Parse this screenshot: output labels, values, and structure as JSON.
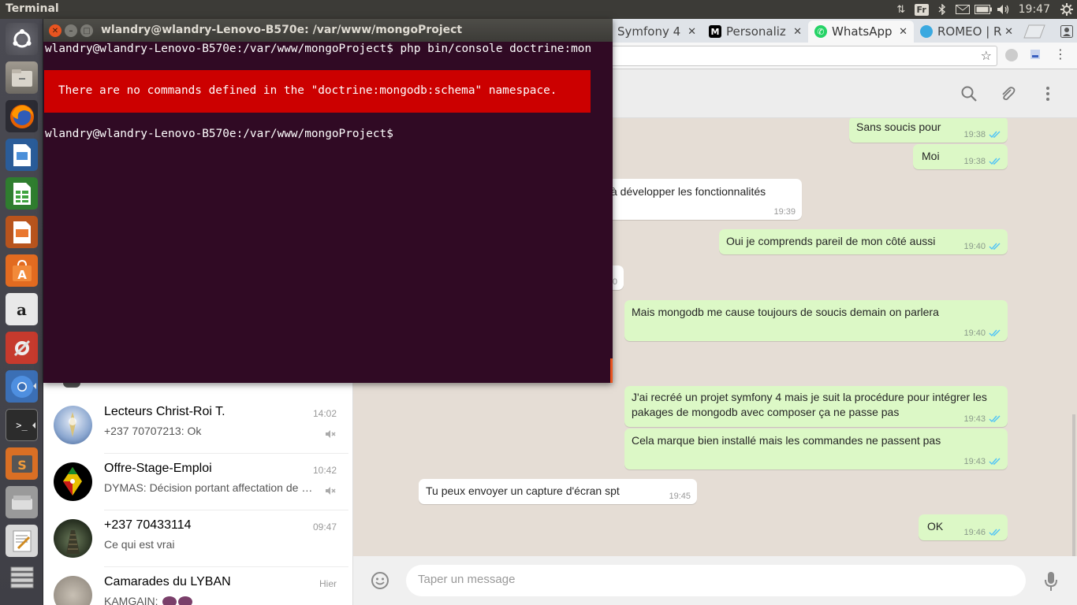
{
  "topbar": {
    "app_title": "Terminal",
    "lang": "Fr",
    "clock": "19:47"
  },
  "terminal": {
    "title": "wlandry@wlandry-Lenovo-B570e: /var/www/mongoProject",
    "line1": "wlandry@wlandry-Lenovo-B570e:/var/www/mongoProject$ php bin/console doctrine:mon",
    "error": "There are no commands defined in the \"doctrine:mongodb:schema\" namespace.",
    "line2": "wlandry@wlandry-Lenovo-B570e:/var/www/mongoProject$"
  },
  "browser": {
    "tabs": [
      {
        "label": "Symfony 4"
      },
      {
        "label": "Personaliz"
      },
      {
        "label": "WhatsApp"
      },
      {
        "label": "ROMEO | R"
      }
    ]
  },
  "chats": [
    {
      "name": "Lecteurs Christ-Roi T.",
      "time": "14:02",
      "preview": "+237 70707213: Ok"
    },
    {
      "name": "Offre-Stage-Emploi",
      "time": "10:42",
      "preview": "DYMAS: Décision portant affectation de c..."
    },
    {
      "name": "+237 70433114",
      "time": "09:47",
      "preview": "Ce qui est vrai"
    },
    {
      "name": "Camarades du LYBAN",
      "time": "Hier",
      "preview": "KAMGAIN: "
    }
  ],
  "messages": [
    {
      "text": "Sans soucis pour",
      "time": "19:38"
    },
    {
      "text": "Moi",
      "time": "19:38"
    },
    {
      "text": "à  développer  les fonctionnalités",
      "time": "19:39"
    },
    {
      "text": "Oui je comprends pareil de mon côté aussi",
      "time": "19:40"
    },
    {
      "text": "0",
      "time": ""
    },
    {
      "text": "Mais mongodb me cause toujours de soucis demain on parlera",
      "time": "19:40"
    },
    {
      "text": "J'ai recréé un projet symfony 4 mais je suit la procédure pour intégrer les",
      "text2": "pakages de mongodb avec composer ça ne passe pas",
      "time": "19:43"
    },
    {
      "text": "Cela marque bien installé mais les commandes ne passent pas",
      "time": "19:43"
    },
    {
      "text": "Tu peux envoyer  un capture d'écran  spt",
      "time": "19:45"
    },
    {
      "text": "OK",
      "time": "19:46"
    }
  ],
  "compose": {
    "placeholder": "Taper un message"
  },
  "colors": {
    "terminal_bg": "#300a24",
    "error_bg": "#cc0000",
    "outgoing_bubble": "#dcf8c6",
    "chat_bg": "#e5ddd5",
    "tick_blue": "#4fc3f7"
  }
}
